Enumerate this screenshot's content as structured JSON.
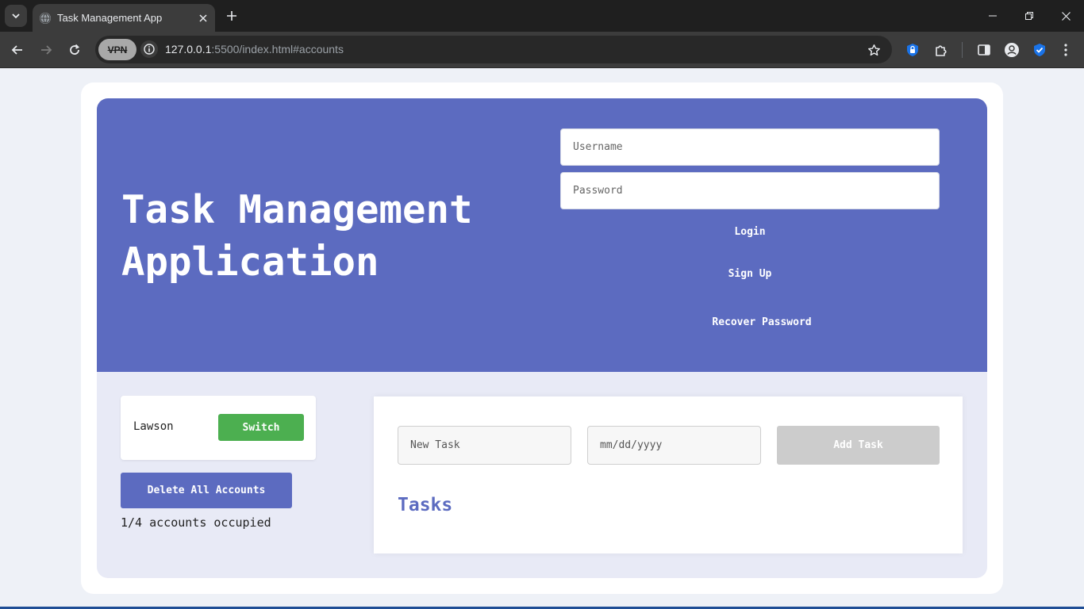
{
  "browser": {
    "tab_title": "Task Management App",
    "url_host": "127.0.0.1",
    "url_rest": ":5500/index.html#accounts",
    "vpn_label": "VPN"
  },
  "header": {
    "title_line1": "Task Management",
    "title_line2": "Application"
  },
  "auth": {
    "username_placeholder": "Username",
    "password_placeholder": "Password",
    "login_label": "Login",
    "signup_label": "Sign Up",
    "recover_label": "Recover Password"
  },
  "accounts": {
    "current_user": "Lawson",
    "switch_label": "Switch",
    "delete_all_label": "Delete All Accounts",
    "occupancy_text": "1/4 accounts occupied"
  },
  "tasks": {
    "new_task_placeholder": "New Task",
    "date_placeholder": "mm/dd/yyyy",
    "add_task_label": "Add Task",
    "heading": "Tasks"
  },
  "colors": {
    "primary": "#5c6bc0",
    "switch_green": "#4caf50",
    "disabled_gray": "#cccccc",
    "lower_bg": "#e8eaf6"
  }
}
